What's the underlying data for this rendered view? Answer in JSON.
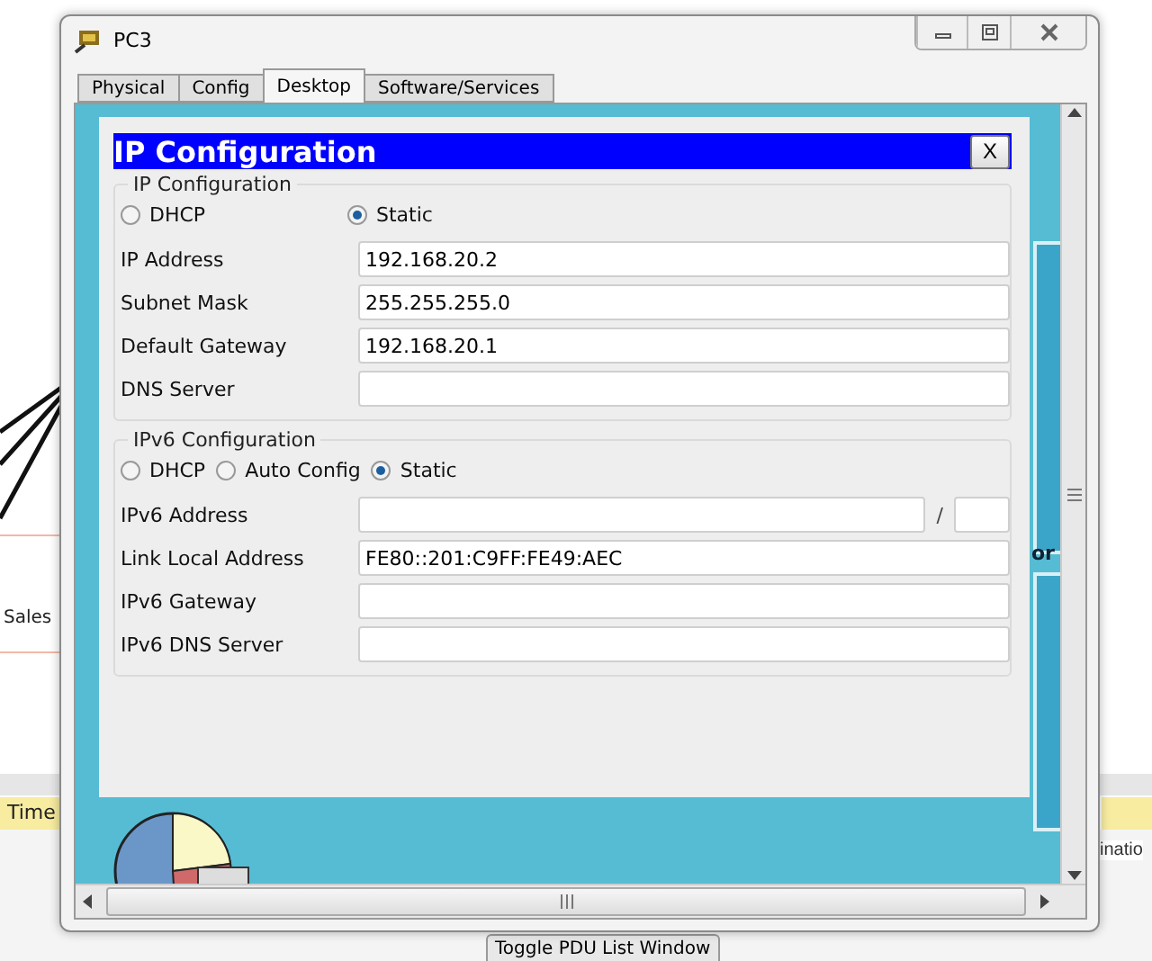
{
  "workspace": {
    "device_label": "Sales",
    "realtime_tab": "Time",
    "right_label": "inatio",
    "toggle_button": "Toggle PDU List Window",
    "desktop_fragment": "or"
  },
  "window": {
    "title": "PC3"
  },
  "tabs": [
    {
      "label": "Physical",
      "selected": false
    },
    {
      "label": "Config",
      "selected": false
    },
    {
      "label": "Desktop",
      "selected": true
    },
    {
      "label": "Software/Services",
      "selected": false
    }
  ],
  "dialog": {
    "title": "IP Configuration",
    "close": "X",
    "ipv4": {
      "legend": "IP Configuration",
      "modes": [
        {
          "label": "DHCP",
          "selected": false
        },
        {
          "label": "Static",
          "selected": true
        }
      ],
      "fields": [
        {
          "label": "IP Address",
          "value": "192.168.20.2"
        },
        {
          "label": "Subnet Mask",
          "value": "255.255.255.0"
        },
        {
          "label": "Default Gateway",
          "value": "192.168.20.1"
        },
        {
          "label": "DNS Server"
        }
      ]
    },
    "ipv6": {
      "legend": "IPv6 Configuration",
      "modes": [
        {
          "label": "DHCP",
          "selected": false
        },
        {
          "label": "Auto Config",
          "selected": false
        },
        {
          "label": "Static",
          "selected": true
        }
      ],
      "fields": [
        {
          "label": "IPv6 Address",
          "kind": "prefixed",
          "separator": "/"
        },
        {
          "label": "Link Local Address",
          "kind": "plain",
          "value": "FE80::201:C9FF:FE49:AEC"
        },
        {
          "label": "IPv6 Gateway",
          "kind": "plain"
        },
        {
          "label": "IPv6 DNS Server",
          "kind": "plain"
        }
      ]
    }
  }
}
